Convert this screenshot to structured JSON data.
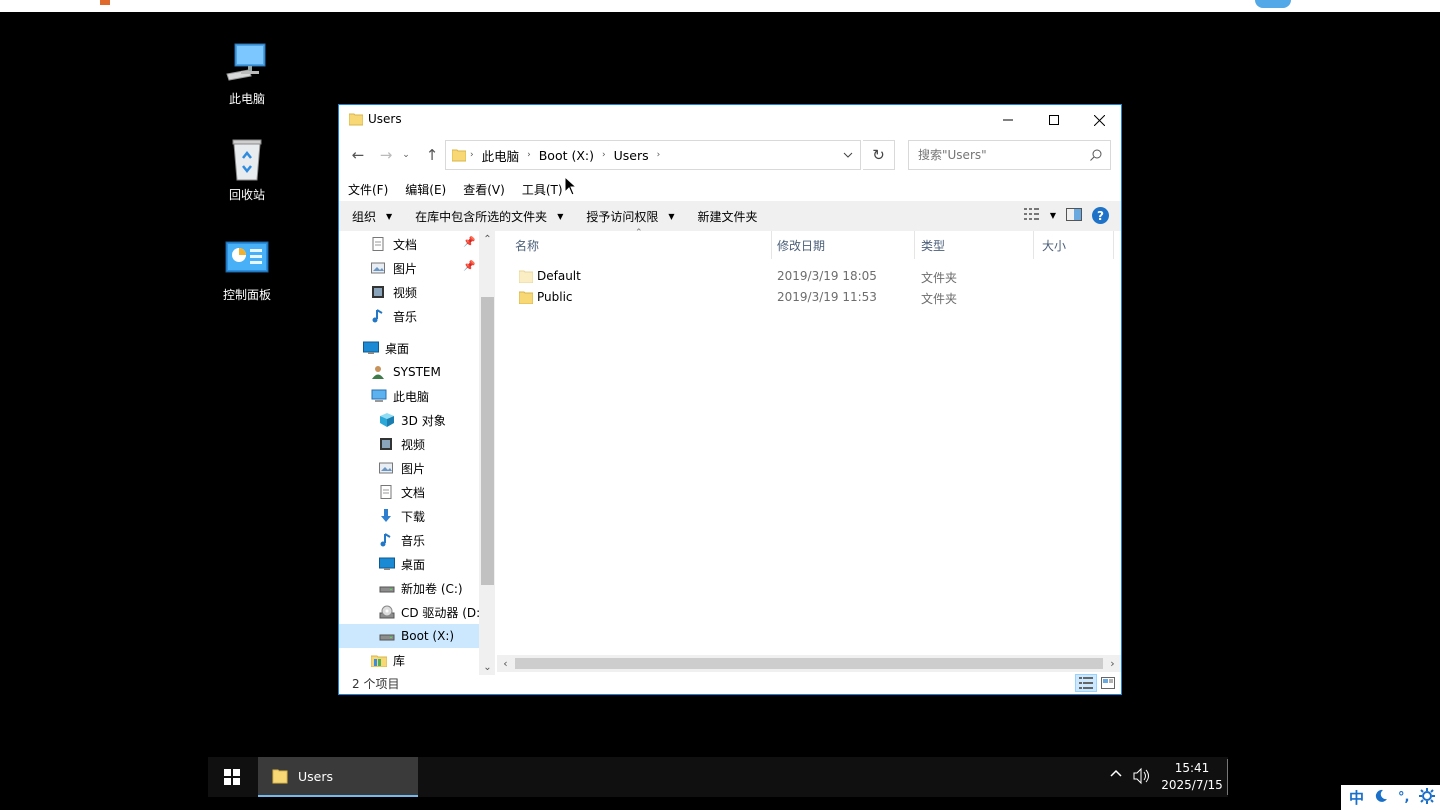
{
  "desktop": {
    "icons": [
      {
        "label": "此电脑",
        "icon": "computer-icon"
      },
      {
        "label": "回收站",
        "icon": "recycle-bin-icon"
      },
      {
        "label": "控制面板",
        "icon": "control-panel-icon"
      }
    ]
  },
  "window": {
    "title": "Users",
    "controls": {
      "minimize": "minimize-icon",
      "maximize": "maximize-icon",
      "close": "close-icon"
    }
  },
  "address": {
    "crumbs": [
      "此电脑",
      "Boot (X:)",
      "Users"
    ]
  },
  "search": {
    "placeholder": "搜索\"Users\""
  },
  "menu": [
    "文件(F)",
    "编辑(E)",
    "查看(V)",
    "工具(T)"
  ],
  "commands": [
    {
      "label": "组织",
      "has_dropdown": true
    },
    {
      "label": "在库中包含所选的文件夹",
      "has_dropdown": true
    },
    {
      "label": "授予访问权限",
      "has_dropdown": true
    },
    {
      "label": "新建文件夹",
      "has_dropdown": false
    }
  ],
  "nav": {
    "items": [
      {
        "label": "文档",
        "icon": "document-icon",
        "pinned": true
      },
      {
        "label": "图片",
        "icon": "pictures-icon",
        "pinned": true
      },
      {
        "label": "视频",
        "icon": "video-icon",
        "pinned": false
      },
      {
        "label": "音乐",
        "icon": "music-icon",
        "pinned": false
      },
      {
        "label": "桌面",
        "icon": "desktop-icon",
        "pinned": false
      },
      {
        "label": "SYSTEM",
        "icon": "user-icon",
        "pinned": false
      },
      {
        "label": "此电脑",
        "icon": "computer-icon",
        "pinned": false
      },
      {
        "label": "3D 对象",
        "icon": "3d-objects-icon",
        "pinned": false
      },
      {
        "label": "视频",
        "icon": "video-icon",
        "pinned": false
      },
      {
        "label": "图片",
        "icon": "pictures-icon",
        "pinned": false
      },
      {
        "label": "文档",
        "icon": "document-icon",
        "pinned": false
      },
      {
        "label": "下载",
        "icon": "download-icon",
        "pinned": false
      },
      {
        "label": "音乐",
        "icon": "music-icon",
        "pinned": false
      },
      {
        "label": "桌面",
        "icon": "desktop-icon",
        "pinned": false
      },
      {
        "label": "新加卷 (C:)",
        "icon": "drive-icon",
        "pinned": false
      },
      {
        "label": "CD 驱动器 (D:",
        "icon": "cd-drive-icon",
        "pinned": false
      },
      {
        "label": "Boot (X:)",
        "icon": "drive-icon",
        "pinned": false,
        "selected": true
      },
      {
        "label": "库",
        "icon": "library-icon",
        "pinned": false
      }
    ]
  },
  "columns": [
    "名称",
    "修改日期",
    "类型",
    "大小"
  ],
  "files": [
    {
      "name": "Default",
      "modified": "2019/3/19 18:05",
      "type": "文件夹",
      "icon": "folder-icon"
    },
    {
      "name": "Public",
      "modified": "2019/3/19 11:53",
      "type": "文件夹",
      "icon": "folder-icon"
    }
  ],
  "status": {
    "count": "2 个项目"
  },
  "taskbar": {
    "app_label": "Users",
    "time": "15:41",
    "date": "2025/7/15"
  },
  "ime": {
    "lang": "中",
    "punct": "°,"
  },
  "colors": {
    "accent": "#1883d7",
    "folder": "#f8d775",
    "selection": "#cce8ff",
    "taskbar": "#101010"
  }
}
